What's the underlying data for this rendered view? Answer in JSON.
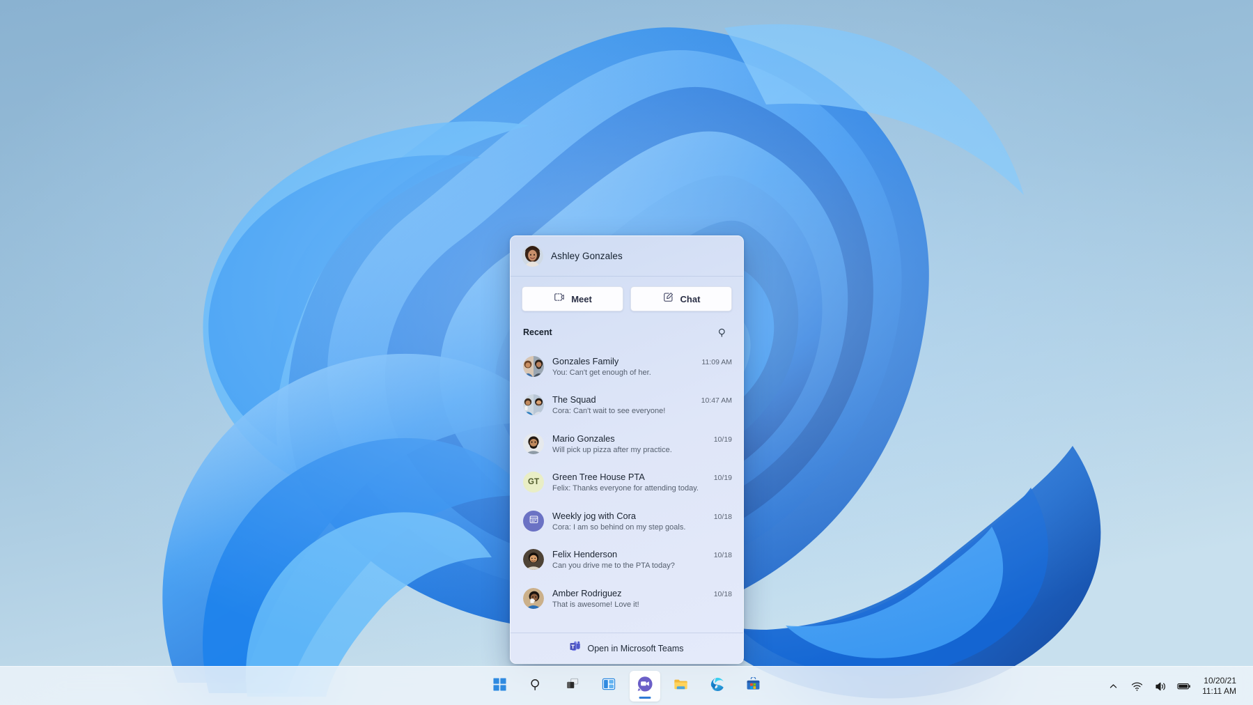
{
  "desktop": {
    "wallpaper_name": "windows-11-bloom-wallpaper",
    "background_color": "#8cb4d2",
    "bloom_color": "#1a7fe8"
  },
  "chat_flyout": {
    "header": {
      "account_name": "Ashley Gonzales",
      "avatar_name": "ashley-gonzales-avatar"
    },
    "actions": [
      {
        "label": "Meet",
        "icon": "video-camera-icon",
        "name": "meet-button"
      },
      {
        "label": "Chat",
        "icon": "compose-chat-icon",
        "name": "chat-button"
      }
    ],
    "recent": {
      "title": "Recent",
      "search_icon": "search-icon"
    },
    "items": [
      {
        "title": "Gonzales Family",
        "preview": "You: Can't get enough of her.",
        "time": "11:09 AM",
        "avatar_type": "photo-group",
        "avatar_name": "gonzales-family-avatar"
      },
      {
        "title": "The Squad",
        "preview": "Cora: Can't wait to see everyone!",
        "time": "10:47 AM",
        "avatar_type": "photo-group",
        "avatar_name": "the-squad-avatar"
      },
      {
        "title": "Mario Gonzales",
        "preview": "Will pick up pizza after my practice.",
        "time": "10/19",
        "avatar_type": "photo",
        "avatar_name": "mario-gonzales-avatar"
      },
      {
        "title": "Green Tree House PTA",
        "preview": "Felix: Thanks everyone for attending today.",
        "time": "10/19",
        "avatar_type": "initials",
        "initials": "GT",
        "avatar_bg": "#e9eec6",
        "avatar_name": "green-tree-house-pta-avatar"
      },
      {
        "title": "Weekly jog with Cora",
        "preview": "Cora: I am so behind on my step goals.",
        "time": "10/18",
        "avatar_type": "icon",
        "icon": "calendar-icon",
        "avatar_bg": "#6b72c4",
        "avatar_name": "weekly-jog-with-cora-avatar"
      },
      {
        "title": "Felix Henderson",
        "preview": "Can you drive me to the PTA today?",
        "time": "10/18",
        "avatar_type": "photo",
        "avatar_name": "felix-henderson-avatar"
      },
      {
        "title": "Amber Rodriguez",
        "preview": "That is awesome! Love it!",
        "time": "10/18",
        "avatar_type": "photo",
        "avatar_name": "amber-rodriguez-avatar"
      }
    ],
    "footer": {
      "label": "Open in Microsoft Teams",
      "icon": "microsoft-teams-icon"
    }
  },
  "taskbar": {
    "buttons": [
      {
        "name": "start-button",
        "icon": "windows-logo-icon",
        "active": false
      },
      {
        "name": "search-taskbar-button",
        "icon": "search-icon",
        "active": false
      },
      {
        "name": "task-view-button",
        "icon": "task-view-icon",
        "active": false
      },
      {
        "name": "widgets-button",
        "icon": "widgets-icon",
        "active": false
      },
      {
        "name": "chat-taskbar-button",
        "icon": "teams-chat-icon",
        "active": true
      },
      {
        "name": "file-explorer-button",
        "icon": "file-explorer-icon",
        "active": false
      },
      {
        "name": "edge-button",
        "icon": "microsoft-edge-icon",
        "active": false
      },
      {
        "name": "microsoft-store-button",
        "icon": "microsoft-store-icon",
        "active": false
      }
    ],
    "tray": {
      "show_hidden_icon": "chevron-up-icon",
      "network_icon": "wifi-icon",
      "volume_icon": "speaker-icon",
      "battery_icon": "battery-icon",
      "date": "10/20/21",
      "time": "11:11 AM"
    }
  }
}
